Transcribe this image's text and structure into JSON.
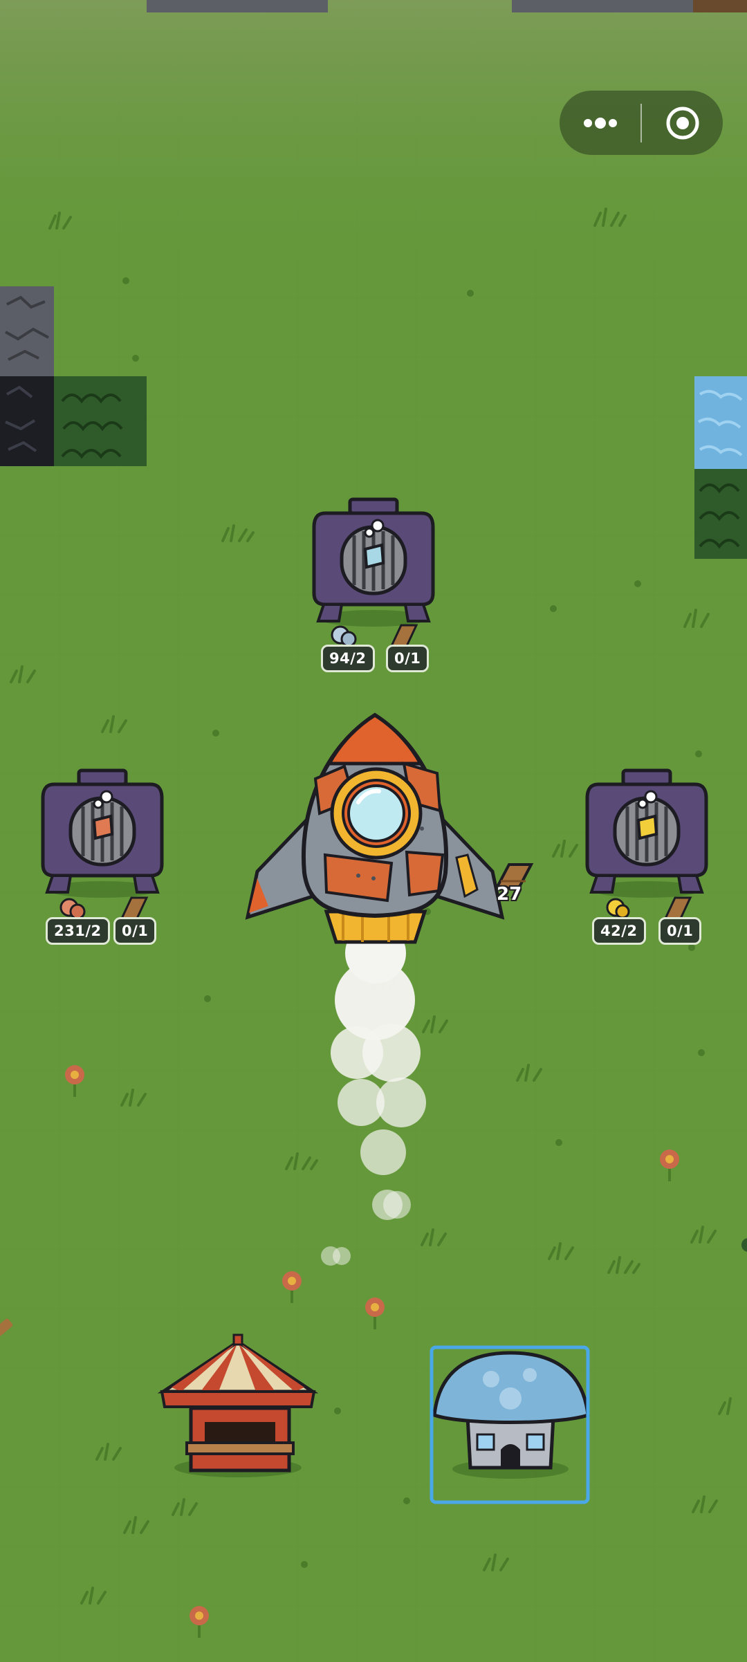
{
  "menu_capsule": {
    "more_icon": "more-dots-icon",
    "close_icon": "target-close-icon"
  },
  "generators": [
    {
      "id": "top",
      "resource_icon": "stone-ore-icon",
      "resource_count": "94/2",
      "wood_count": "0/1",
      "gem_color": "#a8d8e6"
    },
    {
      "id": "left",
      "resource_icon": "copper-ore-icon",
      "resource_count": "231/2",
      "wood_count": "0/1",
      "gem_color": "#e07a52"
    },
    {
      "id": "right",
      "resource_icon": "gold-ore-icon",
      "resource_count": "42/2",
      "wood_count": "0/1",
      "gem_color": "#f2cf3a"
    }
  ],
  "rocket": {
    "wood_count": "27"
  },
  "buildings": {
    "tent": "market-tent",
    "house": "mushroom-house"
  },
  "colors": {
    "grass": "#64983a",
    "selection": "#4aa8e8",
    "machine": "#5a4a78"
  }
}
